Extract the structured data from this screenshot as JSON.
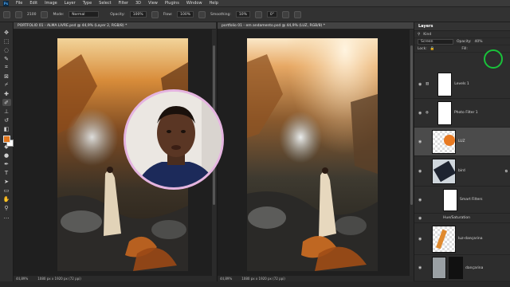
{
  "menubar": {
    "logo": "Ps",
    "items": [
      "File",
      "Edit",
      "Image",
      "Layer",
      "Type",
      "Select",
      "Filter",
      "3D",
      "View",
      "Plugins",
      "Window",
      "Help"
    ]
  },
  "options": {
    "brush_size": "2100",
    "mode_label": "Mode:",
    "mode_value": "Normal",
    "opacity_label": "Opacity:",
    "opacity_value": "100%",
    "flow_label": "Flow:",
    "flow_value": "100%",
    "smoothing_label": "Smoothing:",
    "smoothing_value": "10%",
    "angle_value": "0°"
  },
  "doc1": {
    "tab": "PORTFOLIO 01 - ALMA LIVRE.psd @ 44,9% (Layer 2, RGB/8) *",
    "zoom": "44,89%",
    "size": "1080 px x 1920 px (72 ppi)"
  },
  "doc2": {
    "tab": "portfolio 01 - em andamento.psd @ 44,9% (LUZ, RGB/8) *",
    "zoom": "44,89%",
    "size": "1080 px x 1920 px (72 ppi)"
  },
  "layers_panel": {
    "title": "Layers",
    "filter_label": "Kind",
    "blend_mode": "Screen",
    "opacity_label": "Opacity:",
    "opacity_value": "40%",
    "lock_label": "Lock:",
    "fill_label": "Fill:",
    "layers": [
      {
        "name": "Levels 1"
      },
      {
        "name": "Photo Filter 1"
      },
      {
        "name": "LUZ"
      },
      {
        "name": "bird"
      },
      {
        "name": "Smart Filters"
      },
      {
        "name": "Hue/Saturation"
      },
      {
        "name": "luz-dançarina"
      },
      {
        "name": "dançarina"
      }
    ]
  },
  "colors": {
    "foreground": "#e0751c",
    "background": "#ffffff",
    "highlight_ring": "#19c23a"
  }
}
